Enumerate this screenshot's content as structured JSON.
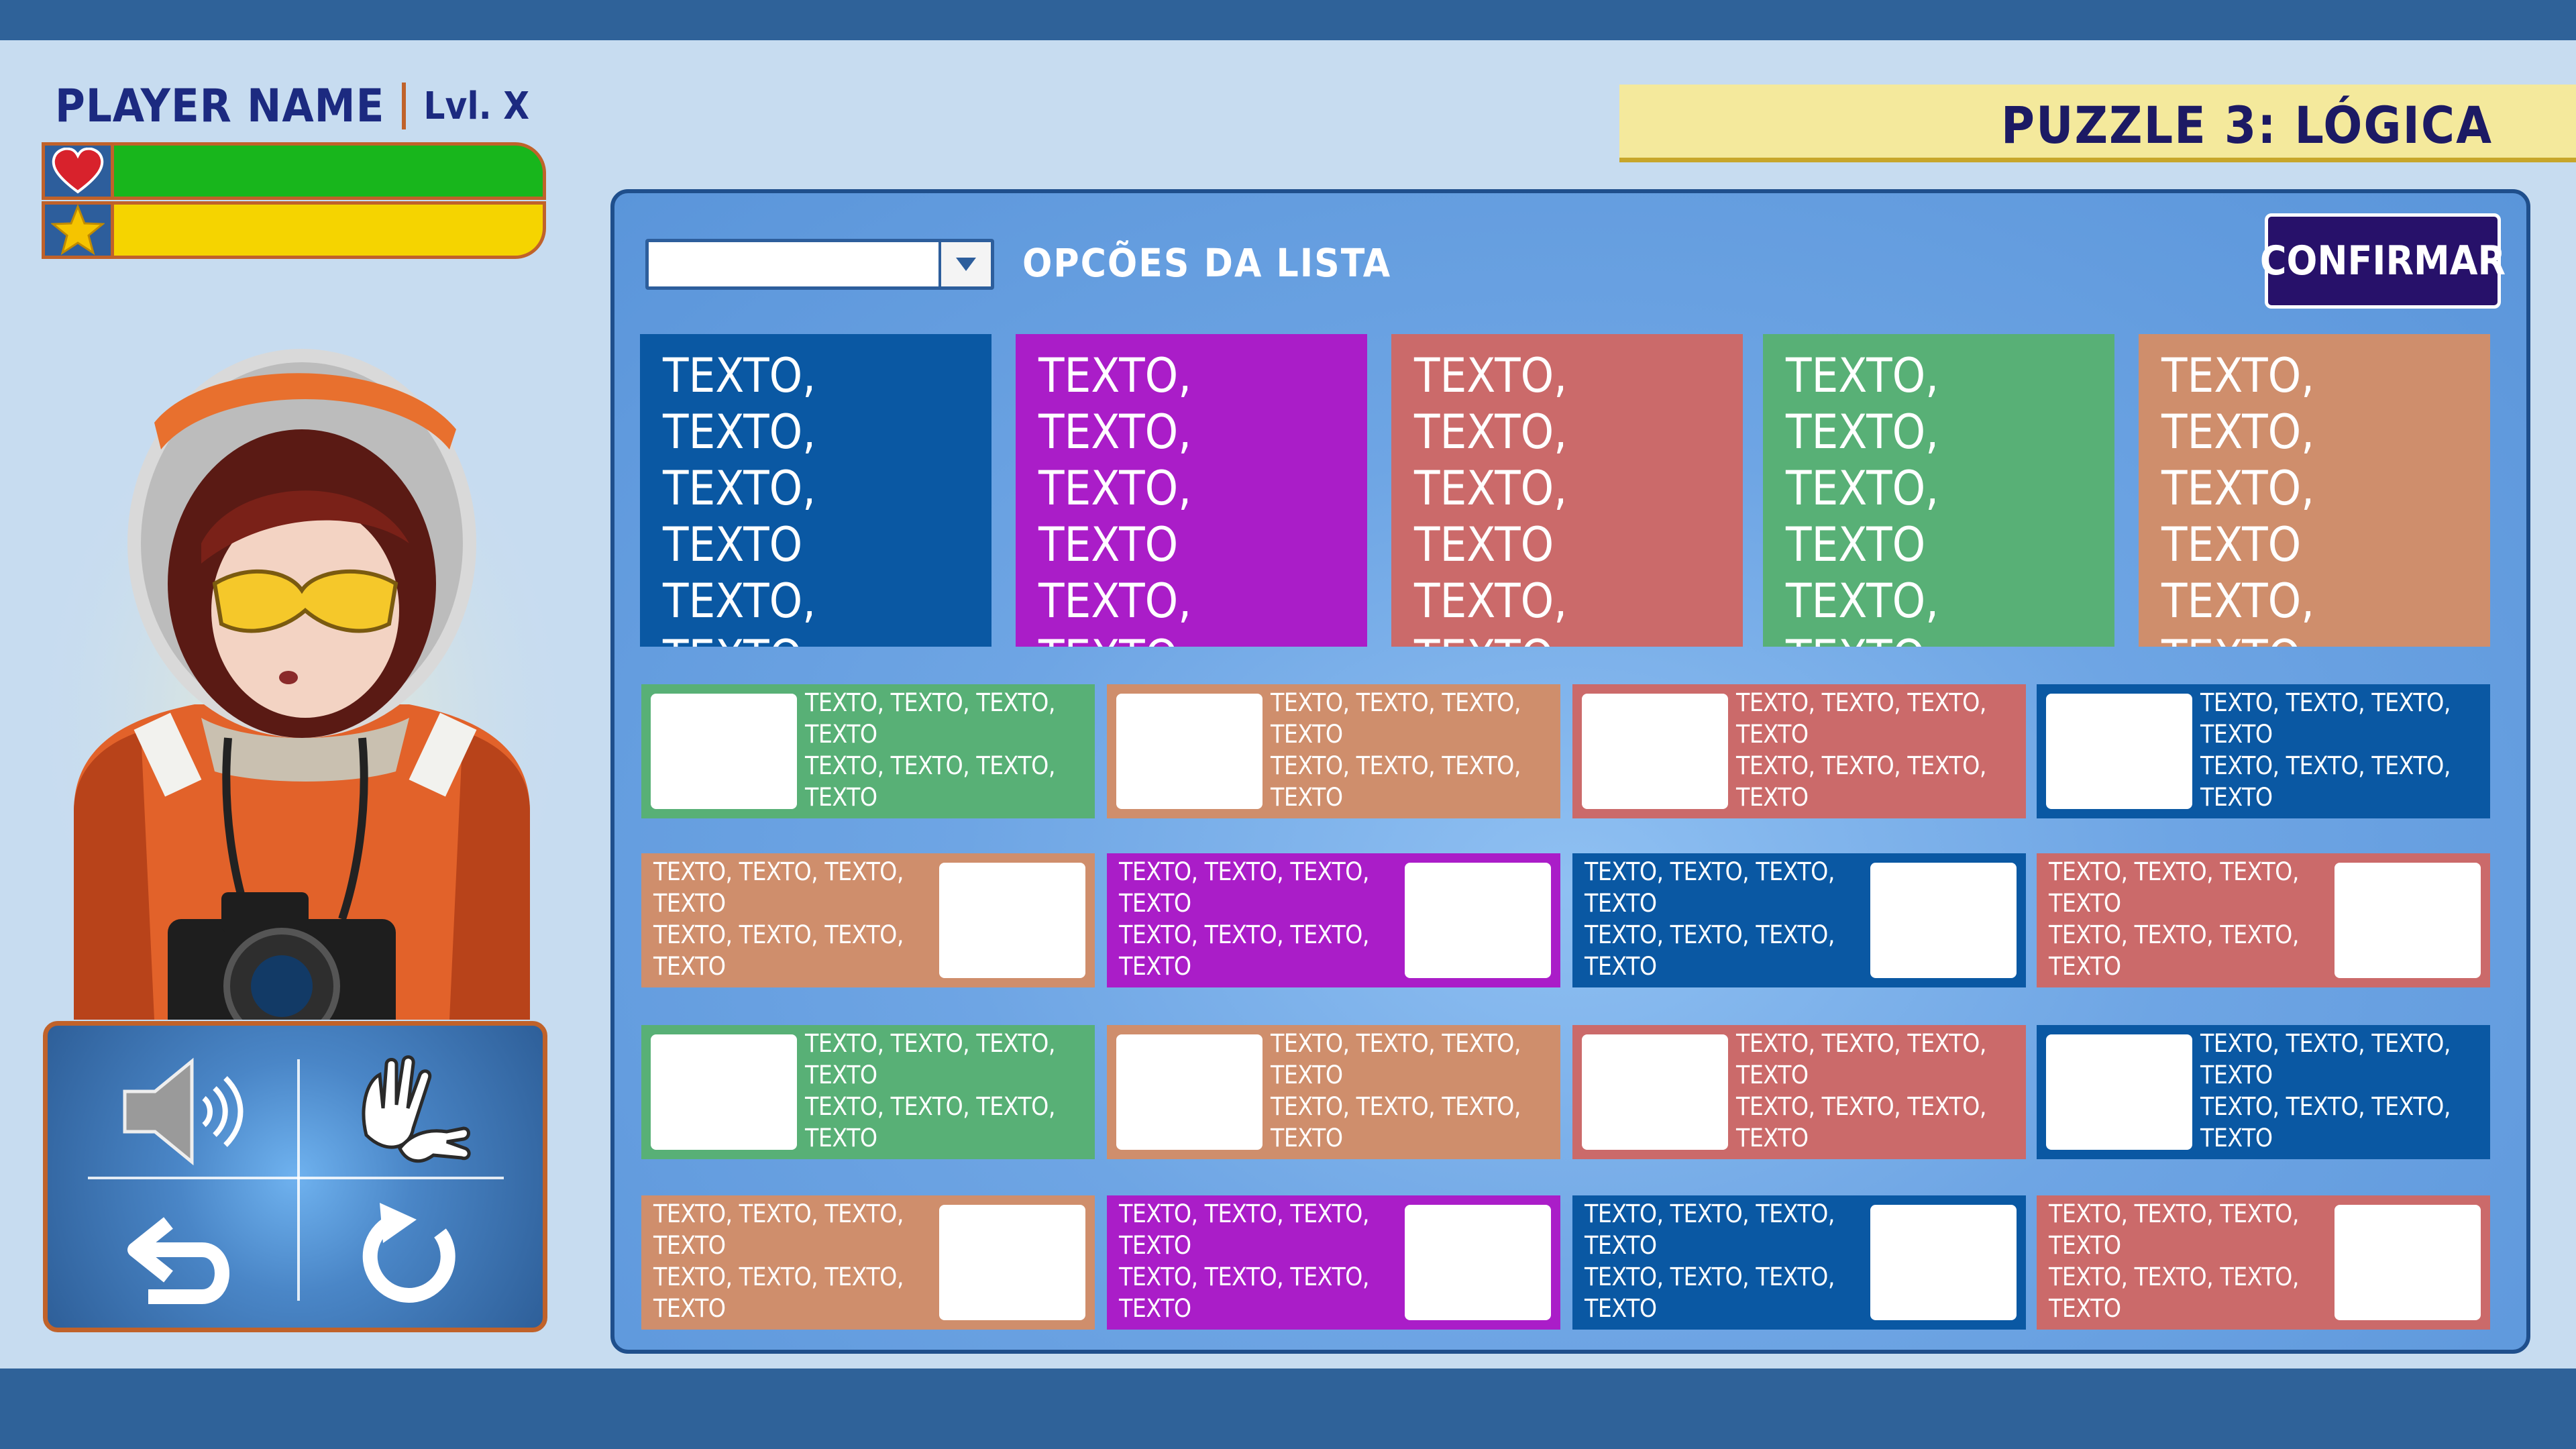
{
  "player": {
    "name": "PLAYER NAME",
    "level": "Lvl. X"
  },
  "puzzle": {
    "title": "PUZZLE 3: LÓGICA"
  },
  "toolbar": {
    "list_label": "OPCÕES DA LISTA",
    "confirm_label": "CONFIRMAR",
    "dropdown_value": ""
  },
  "colors": {
    "blue": "#0a58a3",
    "purple": "#aa1dc8",
    "red": "#cb6a6a",
    "green": "#58b076",
    "tan": "#cf8e6c"
  },
  "clues": [
    {
      "color": "blue",
      "text": "TEXTO, TEXTO, TEXTO, TEXTO TEXTO, TEXTO, TEXTO, TEXTO TEXTO, TEXTO."
    },
    {
      "color": "purple",
      "text": "TEXTO, TEXTO, TEXTO, TEXTO TEXTO, TEXTO, TEXTO, TEXTO TEXTO, TEXTO."
    },
    {
      "color": "red",
      "text": "TEXTO, TEXTO, TEXTO, TEXTO TEXTO, TEXTO, TEXTO, TEXTO TEXTO, TEXTO."
    },
    {
      "color": "green",
      "text": "TEXTO, TEXTO, TEXTO, TEXTO TEXTO, TEXTO, TEXTO, TEXTO TEXTO, TEXTO."
    },
    {
      "color": "tan",
      "text": "TEXTO, TEXTO, TEXTO, TEXTO TEXTO, TEXTO, TEXTO, TEXTO TEXTO, TEXTO."
    }
  ],
  "card_text": "TEXTO, TEXTO, TEXTO, TEXTO\nTEXTO, TEXTO, TEXTO, TEXTO\nTEXTO, TEXTO, TEXTO, TEXTO\nTEXTO, TEXTO, TEXTO, TEXTO.",
  "cards": [
    [
      {
        "color": "green",
        "image": "left"
      },
      {
        "color": "tan",
        "image": "left"
      },
      {
        "color": "red",
        "image": "left"
      },
      {
        "color": "blue",
        "image": "left"
      }
    ],
    [
      {
        "color": "tan",
        "image": "right"
      },
      {
        "color": "purple",
        "image": "right"
      },
      {
        "color": "blue",
        "image": "right"
      },
      {
        "color": "red",
        "image": "right"
      }
    ],
    [
      {
        "color": "green",
        "image": "left"
      },
      {
        "color": "tan",
        "image": "left"
      },
      {
        "color": "red",
        "image": "left"
      },
      {
        "color": "blue",
        "image": "left"
      }
    ],
    [
      {
        "color": "tan",
        "image": "right"
      },
      {
        "color": "purple",
        "image": "right"
      },
      {
        "color": "blue",
        "image": "right"
      },
      {
        "color": "red",
        "image": "right"
      }
    ]
  ],
  "controls": {
    "sound": "speaker-icon",
    "sign_language": "sign-language-icon",
    "back": "undo-icon",
    "restart": "refresh-icon"
  }
}
